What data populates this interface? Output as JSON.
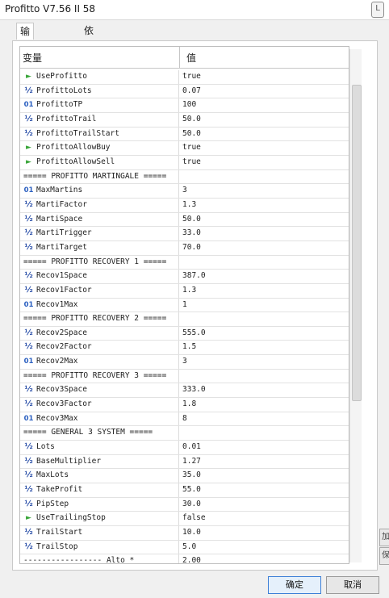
{
  "window": {
    "title": "Profitto V7.56 II 58",
    "close_glyph": "L"
  },
  "tabs": [
    {
      "label": "输入参数"
    },
    {
      "label": "依存关系"
    }
  ],
  "table": {
    "header": {
      "name": "变量",
      "value": "值"
    },
    "rows": [
      {
        "icon": "flag",
        "name": "UseProfitto",
        "value": "true"
      },
      {
        "icon": "half",
        "name": "ProfittoLots",
        "value": "0.07"
      },
      {
        "icon": "int",
        "name": "ProfittoTP",
        "value": "100"
      },
      {
        "icon": "half",
        "name": "ProfittoTrail",
        "value": "50.0"
      },
      {
        "icon": "half",
        "name": "ProfittoTrailStart",
        "value": "50.0"
      },
      {
        "icon": "flag",
        "name": "ProfittoAllowBuy",
        "value": "true"
      },
      {
        "icon": "flag",
        "name": "ProfittoAllowSell",
        "value": "true"
      },
      {
        "icon": "",
        "name": "===== PROFITTO MARTINGALE =====",
        "value": ""
      },
      {
        "icon": "int",
        "name": "MaxMartins",
        "value": "3"
      },
      {
        "icon": "half",
        "name": "MartiFactor",
        "value": "1.3"
      },
      {
        "icon": "half",
        "name": "MartiSpace",
        "value": "50.0"
      },
      {
        "icon": "half",
        "name": "MartiTrigger",
        "value": "33.0"
      },
      {
        "icon": "half",
        "name": "MartiTarget",
        "value": "70.0"
      },
      {
        "icon": "",
        "name": "===== PROFITTO RECOVERY 1 =====",
        "value": ""
      },
      {
        "icon": "half",
        "name": "Recov1Space",
        "value": "387.0"
      },
      {
        "icon": "half",
        "name": "Recov1Factor",
        "value": "1.3"
      },
      {
        "icon": "int",
        "name": "Recov1Max",
        "value": "1"
      },
      {
        "icon": "",
        "name": "===== PROFITTO RECOVERY 2 =====",
        "value": ""
      },
      {
        "icon": "half",
        "name": "Recov2Space",
        "value": "555.0"
      },
      {
        "icon": "half",
        "name": "Recov2Factor",
        "value": "1.5"
      },
      {
        "icon": "int",
        "name": "Recov2Max",
        "value": "3"
      },
      {
        "icon": "",
        "name": "===== PROFITTO RECOVERY 3 =====",
        "value": ""
      },
      {
        "icon": "half",
        "name": "Recov3Space",
        "value": "333.0"
      },
      {
        "icon": "half",
        "name": "Recov3Factor",
        "value": "1.8"
      },
      {
        "icon": "int",
        "name": "Recov3Max",
        "value": "8"
      },
      {
        "icon": "",
        "name": "===== GENERAL 3 SYSTEM =====",
        "value": ""
      },
      {
        "icon": "half",
        "name": "Lots",
        "value": "0.01"
      },
      {
        "icon": "half",
        "name": "BaseMultiplier",
        "value": "1.27"
      },
      {
        "icon": "half",
        "name": "MaxLots",
        "value": "35.0"
      },
      {
        "icon": "half",
        "name": "TakeProfit",
        "value": "55.0"
      },
      {
        "icon": "half",
        "name": "PipStep",
        "value": "30.0"
      },
      {
        "icon": "flag",
        "name": "UseTrailingStop",
        "value": "false"
      },
      {
        "icon": "half",
        "name": "TrailStart",
        "value": "10.0"
      },
      {
        "icon": "half",
        "name": "TrailStop",
        "value": "5.0"
      },
      {
        "icon": "",
        "name": "----------------- Alto      *",
        "value": "2.00"
      }
    ]
  },
  "side_buttons": [
    {
      "label": "加"
    },
    {
      "label": "保"
    }
  ],
  "buttons": {
    "ok": "确定",
    "cancel": "取消"
  },
  "icons": {
    "flag": "►",
    "half": "½",
    "int": "01"
  }
}
